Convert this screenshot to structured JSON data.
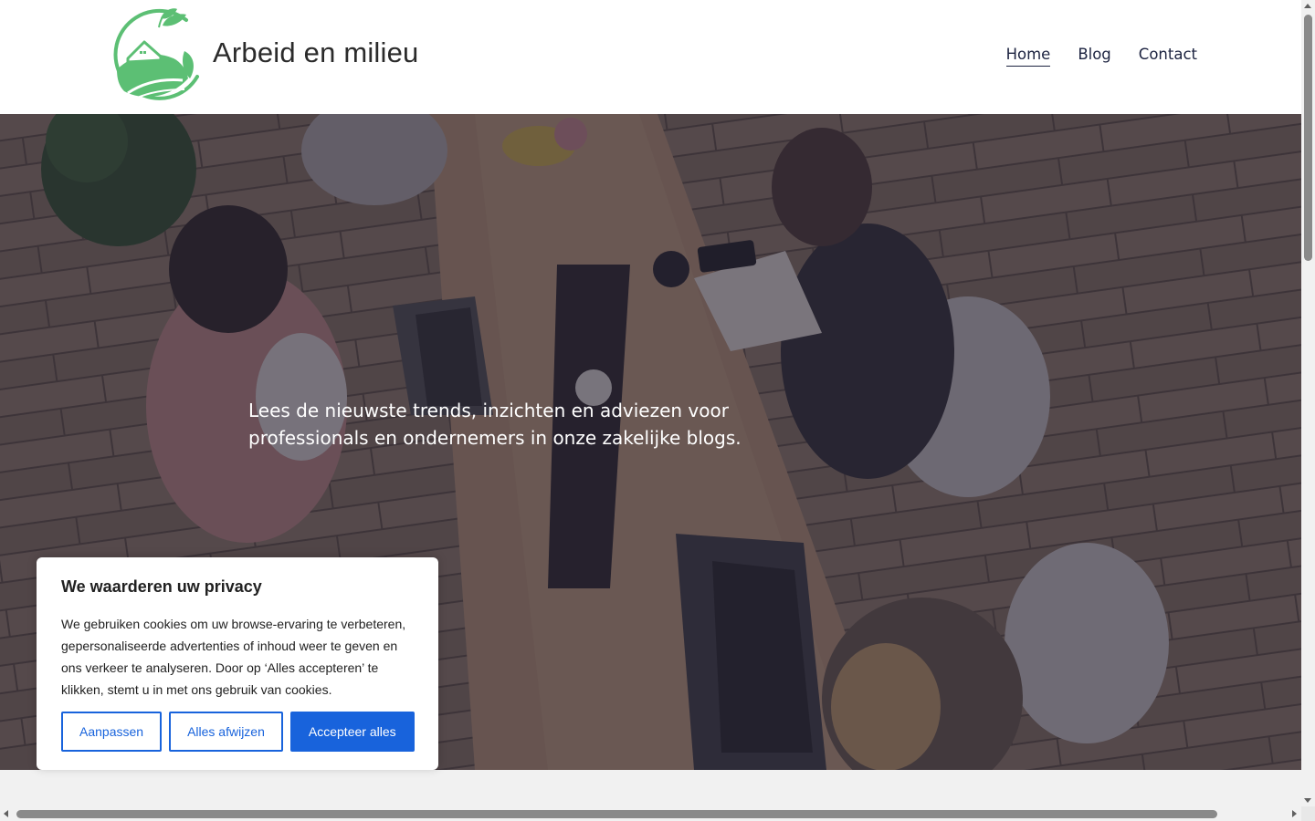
{
  "site": {
    "title": "Arbeid en milieu",
    "logo_icon": "leaf-house-logo",
    "brand_color": "#5cbf74"
  },
  "nav": {
    "items": [
      {
        "label": "Home",
        "active": true
      },
      {
        "label": "Blog",
        "active": false
      },
      {
        "label": "Contact",
        "active": false
      }
    ]
  },
  "hero": {
    "text": "Lees de nieuwste trends, inzichten en adviezen voor professionals en ondernemers in onze zakelijke blogs.",
    "image": "office-meeting-photo"
  },
  "cookie_banner": {
    "title": "We waarderen uw privacy",
    "text": "We gebruiken cookies om uw browse-ervaring te verbeteren, gepersonaliseerde advertenties of inhoud weer te geven en ons verkeer te analyseren. Door op ‘Alles accepteren’ te klikken, stemt u in met ons gebruik van cookies.",
    "buttons": {
      "customize": "Aanpassen",
      "reject": "Alles afwijzen",
      "accept": "Accepteer alles"
    },
    "accent_color": "#1863dc"
  }
}
